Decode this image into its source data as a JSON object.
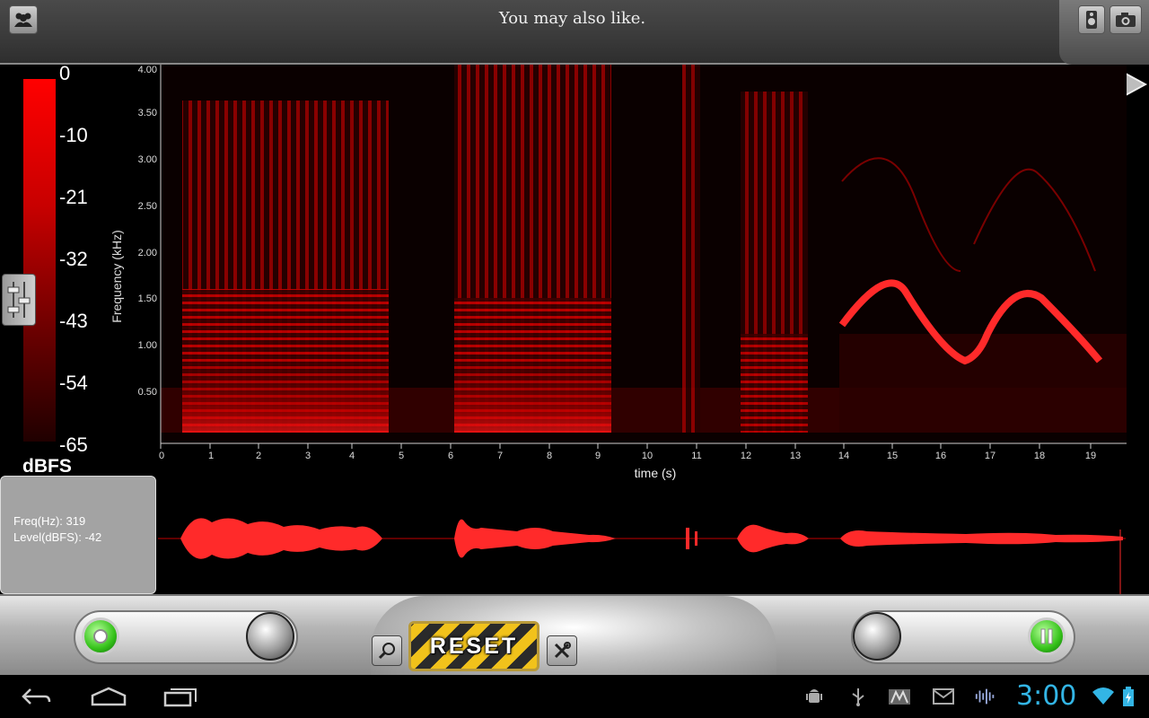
{
  "topbar": {
    "ad_text": "You may also like.",
    "left_icon": "people-icon",
    "right_icons": [
      "speaker-icon",
      "camera-icon"
    ]
  },
  "color_scale": {
    "ticks": [
      "0",
      "-10",
      "-21",
      "-32",
      "-43",
      "-54",
      "-65"
    ],
    "unit": "dBFS"
  },
  "spectrogram": {
    "y_axis_label": "Frequency (kHz)",
    "y_ticks": [
      "4.00",
      "3.50",
      "3.00",
      "2.50",
      "2.00",
      "1.50",
      "1.00",
      "0.50"
    ],
    "x_axis_label": "time (s)",
    "x_ticks": [
      "0",
      "1",
      "2",
      "3",
      "4",
      "5",
      "6",
      "7",
      "8",
      "9",
      "10",
      "11",
      "12",
      "13",
      "14",
      "15",
      "16",
      "17",
      "18",
      "19"
    ]
  },
  "info": {
    "freq": "Freq(Hz): 319",
    "level": "Level(dBFS): -42"
  },
  "controls": {
    "reset_label": "RESET",
    "left_slider": "record-toggle",
    "right_slider": "pause-toggle"
  },
  "system_bar": {
    "clock": "3:00",
    "nav_icons": [
      "back-icon",
      "home-icon",
      "recent-apps-icon"
    ],
    "status_icons": [
      "android-debug-icon",
      "usb-icon",
      "store-icon",
      "gmail-icon",
      "audio-app-icon",
      "wifi-icon",
      "battery-icon"
    ],
    "accent": "#33b5e5"
  },
  "colors": {
    "spectrogram": "#ff0000",
    "record_button": "#35c21a"
  }
}
